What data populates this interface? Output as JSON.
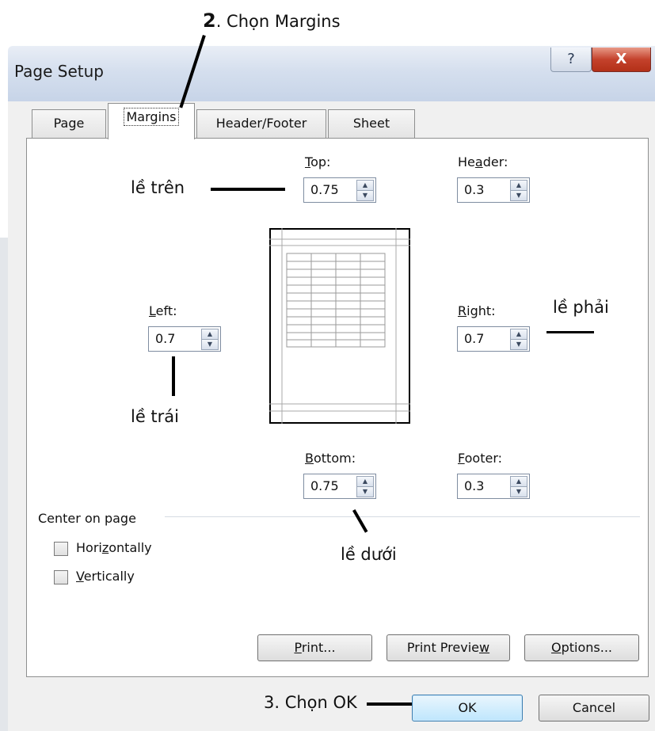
{
  "window": {
    "title": "Page Setup",
    "help_glyph": "?",
    "close_glyph": "X"
  },
  "tabs": [
    {
      "label": "Page"
    },
    {
      "label": "Margins"
    },
    {
      "label": "Header/Footer"
    },
    {
      "label": "Sheet"
    }
  ],
  "margins": {
    "top": {
      "label_pre": "",
      "label_key": "T",
      "label_post": "op:",
      "value": "0.75"
    },
    "header": {
      "label_pre": "He",
      "label_key": "a",
      "label_post": "der:",
      "value": "0.3"
    },
    "left": {
      "label_pre": "",
      "label_key": "L",
      "label_post": "eft:",
      "value": "0.7"
    },
    "right": {
      "label_pre": "",
      "label_key": "R",
      "label_post": "ight:",
      "value": "0.7"
    },
    "bottom": {
      "label_pre": "",
      "label_key": "B",
      "label_post": "ottom:",
      "value": "0.75"
    },
    "footer": {
      "label_pre": "",
      "label_key": "F",
      "label_post": "ooter:",
      "value": "0.3"
    }
  },
  "center_on_page": {
    "label": "Center on page",
    "horizontally": {
      "pre": "Hori",
      "key": "z",
      "post": "ontally",
      "checked": false
    },
    "vertically": {
      "pre": "",
      "key": "V",
      "post": "ertically",
      "checked": false
    }
  },
  "buttons": {
    "print": {
      "pre": "",
      "key": "P",
      "post": "rint..."
    },
    "preview": {
      "pre": "Print Previe",
      "key": "w",
      "post": ""
    },
    "options": {
      "pre": "",
      "key": "O",
      "post": "ptions..."
    },
    "ok": "OK",
    "cancel": "Cancel"
  },
  "annotations": {
    "step2_num": "2",
    "step2_text": ". Chọn Margins",
    "top": "lề trên",
    "right": "lề phải",
    "left": "lề trái",
    "bottom": "lề dưới",
    "step3": "3. Chọn OK"
  }
}
